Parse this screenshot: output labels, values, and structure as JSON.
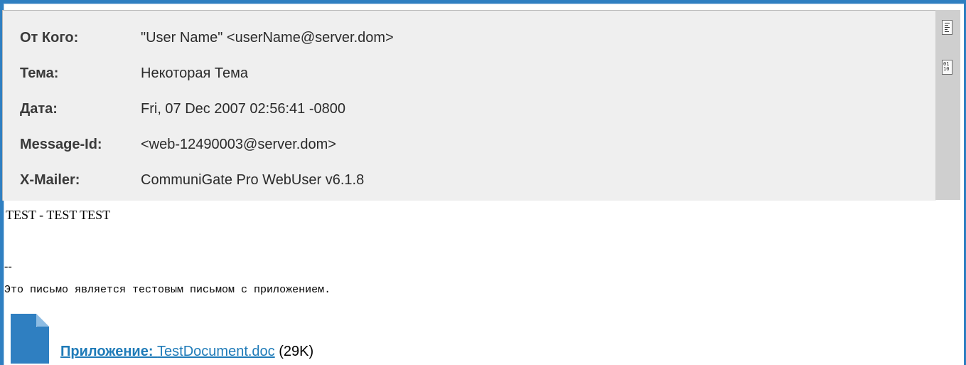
{
  "headers": [
    {
      "label": "От Кого:",
      "value": "\"User Name\" <userName@server.dom>"
    },
    {
      "label": "Тема:",
      "value": "Некоторая Тема"
    },
    {
      "label": "Дата:",
      "value": "Fri, 07 Dec 2007 02:56:41 -0800"
    },
    {
      "label": "Message-Id:",
      "value": "<web-12490003@server.dom>"
    },
    {
      "label": "X-Mailer:",
      "value": "CommuniGate Pro WebUser v6.1.8"
    }
  ],
  "side_icons": [
    "headers-list-icon",
    "raw-source-icon"
  ],
  "body": {
    "text": "TEST - TEST TEST",
    "signature_separator": "--",
    "signature_text": "Это письмо является тестовым письмом с приложением."
  },
  "attachment": {
    "prefix": "Приложение:",
    "filename": "TestDocument.doc",
    "size": "(29K)",
    "icon": "document-icon",
    "icon_color": "#2f7fc1"
  },
  "colors": {
    "frame": "#2f7fc1",
    "header_bg": "#efefef",
    "side_bg": "#cfcfcf",
    "link": "#1f7bb8"
  }
}
